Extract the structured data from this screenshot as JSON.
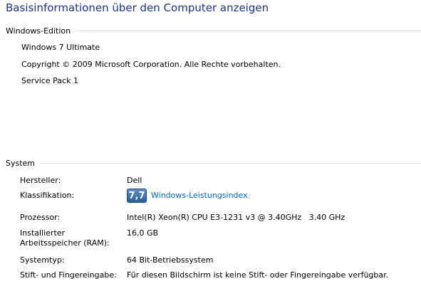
{
  "page_title": "Basisinformationen über den Computer anzeigen",
  "windows_edition": {
    "header": "Windows-Edition",
    "edition": "Windows 7 Ultimate",
    "copyright": "Copyright © 2009 Microsoft Corporation. Alle Rechte vorbehalten.",
    "service_pack": "Service Pack 1"
  },
  "system": {
    "header": "System",
    "hersteller_label": "Hersteller:",
    "hersteller_value": "Dell",
    "klassifikation_label": "Klassifikation:",
    "wei_score": "7,7",
    "wei_link": "Windows-Leistungsindex",
    "prozessor_label": "Prozessor:",
    "prozessor_value": "Intel(R) Xeon(R) CPU E3-1231 v3 @ 3.40GHz   3.40 GHz",
    "ram_label": "Installierter Arbeitsspeicher (RAM):",
    "ram_value": "16,0 GB",
    "systemtyp_label": "Systemtyp:",
    "systemtyp_value": "64 Bit-Betriebssystem",
    "stift_label": "Stift- und Fingereingabe:",
    "stift_value": "Für diesen Bildschirm ist keine Stift- oder Fingereingabe verfügbar."
  },
  "colors": {
    "title": "#1e3287",
    "link": "#0066cc",
    "rule": "#d5dfe5"
  }
}
